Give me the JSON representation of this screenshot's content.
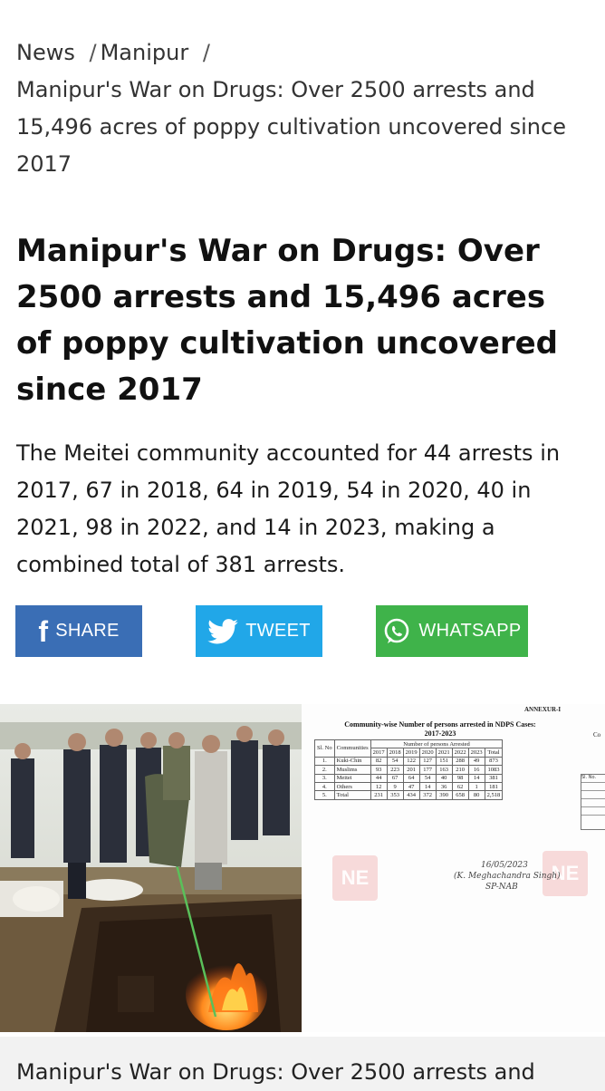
{
  "breadcrumb": {
    "items": [
      "News",
      "Manipur"
    ],
    "separator": "/",
    "current": "Manipur's War on Drugs: Over 2500 arrests and 15,496 acres of poppy cultivation uncovered since 2017"
  },
  "article": {
    "headline": "Manipur's War on Drugs: Over 2500 arrests and 15,496 acres of poppy cultivation uncovered since 2017",
    "summary": "The Meitei community accounted for 44 arrests in 2017, 67 in 2018, 64 in 2019, 54 in 2020, 40 in 2021, 98 in 2022, and 14 in 2023, making a combined total of 381 arrests."
  },
  "share": {
    "facebook_label": "SHARE",
    "twitter_label": "TWEET",
    "whatsapp_label": "WHATSAPP",
    "facebook_icon": "f",
    "colors": {
      "facebook": "#3a6eb5",
      "twitter": "#21a7e8",
      "whatsapp": "#3fb34a"
    }
  },
  "image": {
    "photo_icon": "drug-destruction-photo",
    "document": {
      "annex": "ANNEXUR-I",
      "title_line1": "Community-wise Number of persons arrested in NDPS Cases:",
      "title_line2": "2017-2023",
      "col_sl": "Sl. No",
      "col_communities": "Communities",
      "col_group": "Number of persons Arrested",
      "years": [
        "2017",
        "2018",
        "2019",
        "2020",
        "2021",
        "2022",
        "2023",
        "Total"
      ],
      "rows": [
        {
          "sl": "1.",
          "community": "Kuki-Chin",
          "values": [
            "82",
            "54",
            "122",
            "127",
            "151",
            "288",
            "49",
            "873"
          ]
        },
        {
          "sl": "2.",
          "community": "Muslims",
          "values": [
            "93",
            "223",
            "201",
            "177",
            "163",
            "210",
            "16",
            "1083"
          ]
        },
        {
          "sl": "3.",
          "community": "Meitei",
          "values": [
            "44",
            "67",
            "64",
            "54",
            "40",
            "98",
            "14",
            "381"
          ]
        },
        {
          "sl": "4.",
          "community": "Others",
          "values": [
            "12",
            "9",
            "47",
            "14",
            "36",
            "62",
            "1",
            "181"
          ]
        },
        {
          "sl": "5.",
          "community": "Total",
          "values": [
            "231",
            "353",
            "434",
            "372",
            "390",
            "658",
            "80",
            "2,518"
          ]
        }
      ],
      "signature_line1": "16/05/2023",
      "signature_line2": "(K. Meghachandra Singh)",
      "signature_line3": "SP-NAB",
      "watermark": "NE",
      "right_fragment": "Co",
      "right_fragment_col": "Sl. No."
    }
  },
  "caption": {
    "text": "Manipur's War on Drugs: Over 2500 arrests and"
  }
}
